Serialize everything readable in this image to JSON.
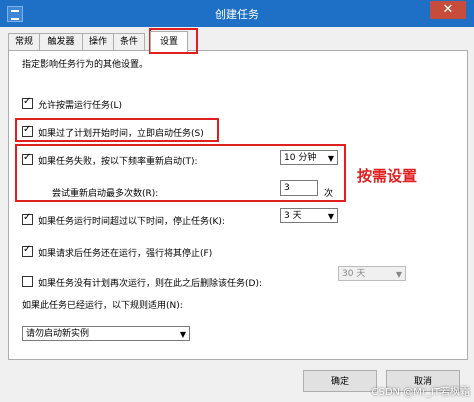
{
  "window": {
    "title": "创建任务",
    "close_label": "✕"
  },
  "tabs": [
    {
      "label": "常规"
    },
    {
      "label": "触发器"
    },
    {
      "label": "操作"
    },
    {
      "label": "条件"
    },
    {
      "label": "设置"
    }
  ],
  "settings": {
    "description": "指定影响任务行为的其他设置。",
    "allow_on_demand": {
      "label": "允许按需运行任务(L)",
      "checked": true
    },
    "run_asap_after_missed": {
      "label": "如果过了计划开始时间，立即启动任务(S)",
      "checked": true
    },
    "restart_on_failure": {
      "label": "如果任务失败，按以下频率重新启动(T):",
      "checked": true,
      "interval_value": "10 分钟"
    },
    "restart_attempts": {
      "label": "尝试重新启动最多次数(R):",
      "value": "3",
      "unit": "次"
    },
    "stop_if_runs_longer": {
      "label": "如果任务运行时间超过以下时间，停止任务(K):",
      "checked": true,
      "value": "3 天"
    },
    "force_stop": {
      "label": "如果请求后任务还在运行，强行将其停止(F)",
      "checked": true
    },
    "delete_if_not_scheduled": {
      "label": "如果任务没有计划再次运行，则在此之后删除该任务(D):",
      "checked": false,
      "value": "30 天"
    },
    "already_running_label": "如果此任务已经运行，以下规则适用(N):",
    "already_running_value": "请勿启动新实例"
  },
  "annotation": "按需设置",
  "buttons": {
    "ok": "确定",
    "cancel": "取消"
  },
  "watermark": "CSDN @Mr_IT若枫霜"
}
